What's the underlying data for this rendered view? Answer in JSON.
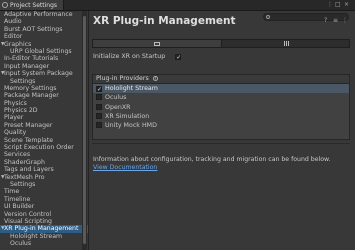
{
  "window": {
    "tab_label": "Project Settings",
    "controls": [
      "⋮",
      "□",
      "×"
    ]
  },
  "sidebar": {
    "items": [
      {
        "label": "Adaptive Performance",
        "level": 0
      },
      {
        "label": "Audio",
        "level": 0
      },
      {
        "label": "Burst AOT Settings",
        "level": 0
      },
      {
        "label": "Editor",
        "level": 0
      },
      {
        "label": "Graphics",
        "level": 0,
        "expanded": true
      },
      {
        "label": "URP Global Settings",
        "level": 1
      },
      {
        "label": "In-Editor Tutorials",
        "level": 0
      },
      {
        "label": "Input Manager",
        "level": 0
      },
      {
        "label": "Input System Package",
        "level": 0,
        "expanded": true
      },
      {
        "label": "Settings",
        "level": 1
      },
      {
        "label": "Memory Settings",
        "level": 0
      },
      {
        "label": "Package Manager",
        "level": 0
      },
      {
        "label": "Physics",
        "level": 0
      },
      {
        "label": "Physics 2D",
        "level": 0
      },
      {
        "label": "Player",
        "level": 0
      },
      {
        "label": "Preset Manager",
        "level": 0
      },
      {
        "label": "Quality",
        "level": 0
      },
      {
        "label": "Scene Template",
        "level": 0
      },
      {
        "label": "Script Execution Order",
        "level": 0
      },
      {
        "label": "Services",
        "level": 0
      },
      {
        "label": "ShaderGraph",
        "level": 0
      },
      {
        "label": "Tags and Layers",
        "level": 0
      },
      {
        "label": "TextMesh Pro",
        "level": 0,
        "expanded": true
      },
      {
        "label": "Settings",
        "level": 1
      },
      {
        "label": "Time",
        "level": 0
      },
      {
        "label": "Timeline",
        "level": 0
      },
      {
        "label": "UI Builder",
        "level": 0
      },
      {
        "label": "Version Control",
        "level": 0
      },
      {
        "label": "Visual Scripting",
        "level": 0
      },
      {
        "label": "XR Plug-in Management",
        "level": 0,
        "expanded": true,
        "selected": true
      },
      {
        "label": "Hololight Stream",
        "level": 1
      },
      {
        "label": "Oculus",
        "level": 1
      }
    ]
  },
  "main": {
    "title": "XR Plug-in Management",
    "initialize_label": "Initialize XR on Startup",
    "initialize_checked": "✓",
    "providers_header": "Plug-in Providers",
    "help": "?",
    "providers": [
      {
        "label": "Hololight Stream",
        "checked": "✓"
      },
      {
        "label": "Oculus",
        "checked": ""
      },
      {
        "label": "OpenXR",
        "checked": ""
      },
      {
        "label": "XR Simulation",
        "checked": ""
      },
      {
        "label": "Unity Mock HMD",
        "checked": ""
      }
    ],
    "info_text": "Information about configuration, tracking and migration can be found below.",
    "info_link": "View Documentation"
  },
  "colors": {
    "background": "#383838",
    "selected": "#2c5d87",
    "link": "#6aa6e8"
  }
}
